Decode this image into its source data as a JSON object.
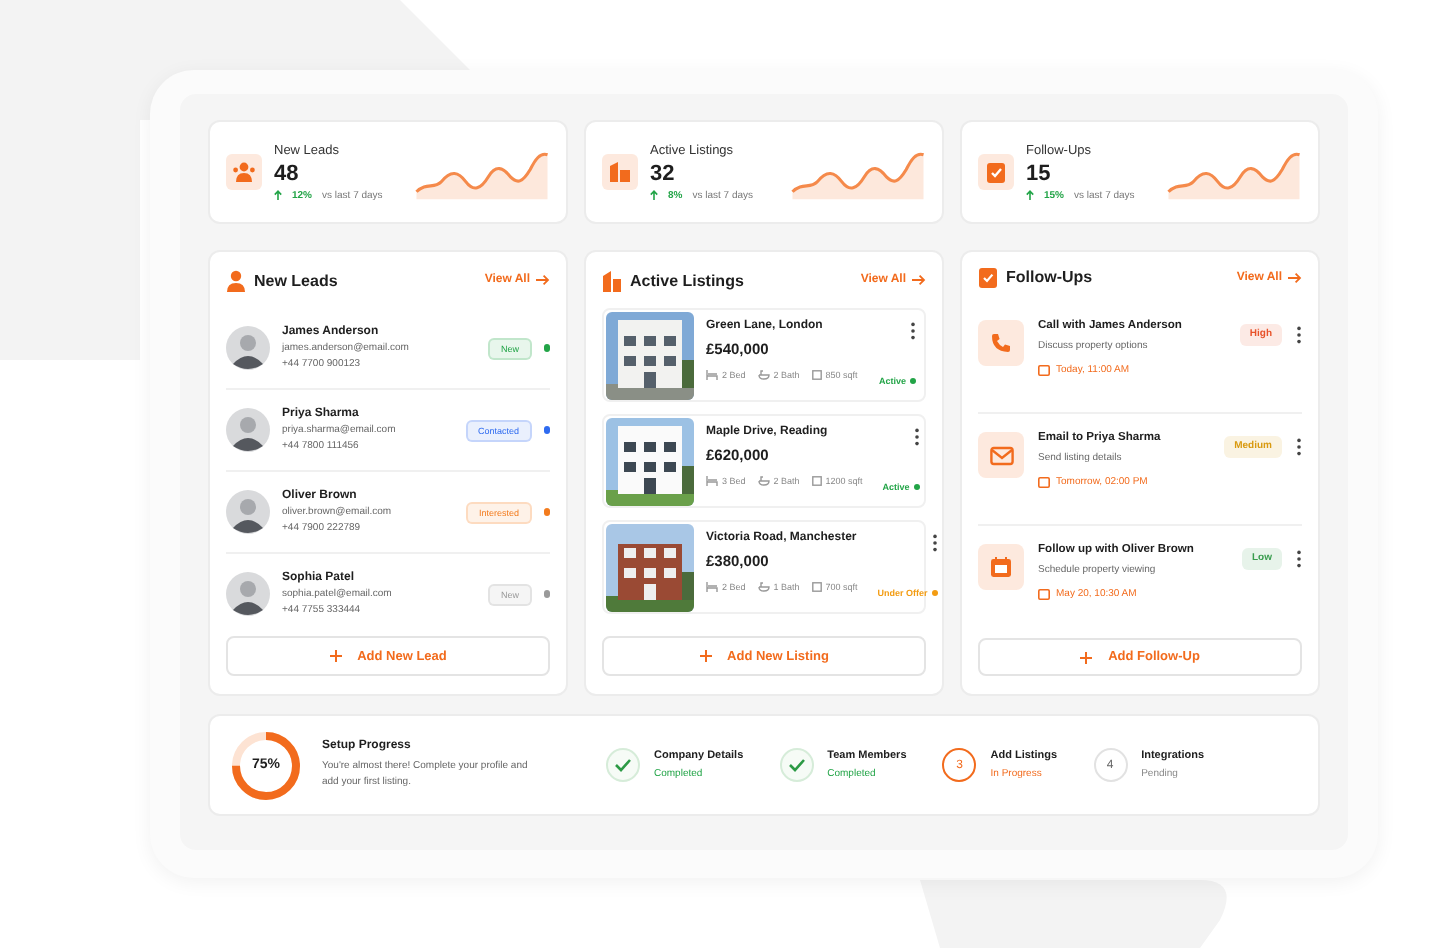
{
  "stats": [
    {
      "kind": "leads",
      "label": "New Leads",
      "value": "48",
      "change": "12%",
      "period": "vs last 7 days"
    },
    {
      "kind": "listings",
      "label": "Active Listings",
      "value": "32",
      "change": "8%",
      "period": "vs last 7 days"
    },
    {
      "kind": "followups",
      "label": "Follow-Ups",
      "value": "15",
      "change": "15%",
      "period": "vs last 7 days"
    }
  ],
  "leads": {
    "title": "New Leads",
    "view_all": "View All",
    "add": "Add New Lead",
    "items": [
      {
        "name": "James Anderson",
        "email": "james.anderson@email.com",
        "phone": "+44 7700 900123",
        "status": "New",
        "color": "#22a447"
      },
      {
        "name": "Priya Sharma",
        "email": "priya.sharma@email.com",
        "phone": "+44 7800 111456",
        "status": "Contacted",
        "color": "#2f6bf0"
      },
      {
        "name": "Oliver Brown",
        "email": "oliver.brown@email.com",
        "phone": "+44 7900 222789",
        "status": "Interested",
        "color": "#f37b1d"
      },
      {
        "name": "Sophia Patel",
        "email": "sophia.patel@email.com",
        "phone": "+44 7755 333444",
        "status": "New",
        "color": "#9a9a9a"
      }
    ]
  },
  "listings": {
    "title": "Active Listings",
    "view_all": "View All",
    "add": "Add New Listing",
    "items": [
      {
        "title": "Green Lane, London",
        "price": "£540,000",
        "beds": "2 Bed",
        "baths": "2 Bath",
        "area": "850 sqft",
        "status": "Active",
        "color": "#22a447"
      },
      {
        "title": "Maple Drive, Reading",
        "price": "£620,000",
        "beds": "3 Bed",
        "baths": "2 Bath",
        "area": "1200 sqft",
        "status": "Active",
        "color": "#22a447"
      },
      {
        "title": "Victoria Road, Manchester",
        "price": "£380,000",
        "beds": "2 Bed",
        "baths": "1 Bath",
        "area": "700 sqft",
        "status": "Under Offer",
        "color": "#f39c12"
      }
    ]
  },
  "followups": {
    "title": "Follow-Ups",
    "view_all": "View All",
    "add": "Add Follow-Up",
    "items": [
      {
        "kind": "call",
        "title": "Call with James Anderson",
        "detail": "Discuss property options",
        "when": "Today, 11:00 AM",
        "priority": {
          "label": "High",
          "color": "#e8532b"
        }
      },
      {
        "kind": "email",
        "title": "Email to Priya Sharma",
        "detail": "Send listing details",
        "when": "Tomorrow, 02:00 PM",
        "priority": {
          "label": "Medium",
          "color": "#d99a10"
        }
      },
      {
        "kind": "meeting",
        "title": "Follow up with Oliver Brown",
        "detail": "Schedule property viewing",
        "when": "May 20, 10:30 AM",
        "priority": {
          "label": "Low",
          "color": "#3a9d4f"
        }
      }
    ]
  },
  "setup": {
    "title": "Setup Progress",
    "percent": "75%",
    "level": 0.75,
    "message": "You're almost there! Complete your profile and add your first listing.",
    "steps": [
      {
        "kind": "done",
        "label": "Company Details",
        "status": "Completed"
      },
      {
        "kind": "done",
        "label": "Team Members",
        "status": "Completed"
      },
      {
        "kind": "active",
        "number": "3",
        "label": "Add Listings",
        "status": "In Progress"
      },
      {
        "kind": "pending",
        "number": "4",
        "label": "Integrations",
        "status": "Pending"
      }
    ]
  }
}
